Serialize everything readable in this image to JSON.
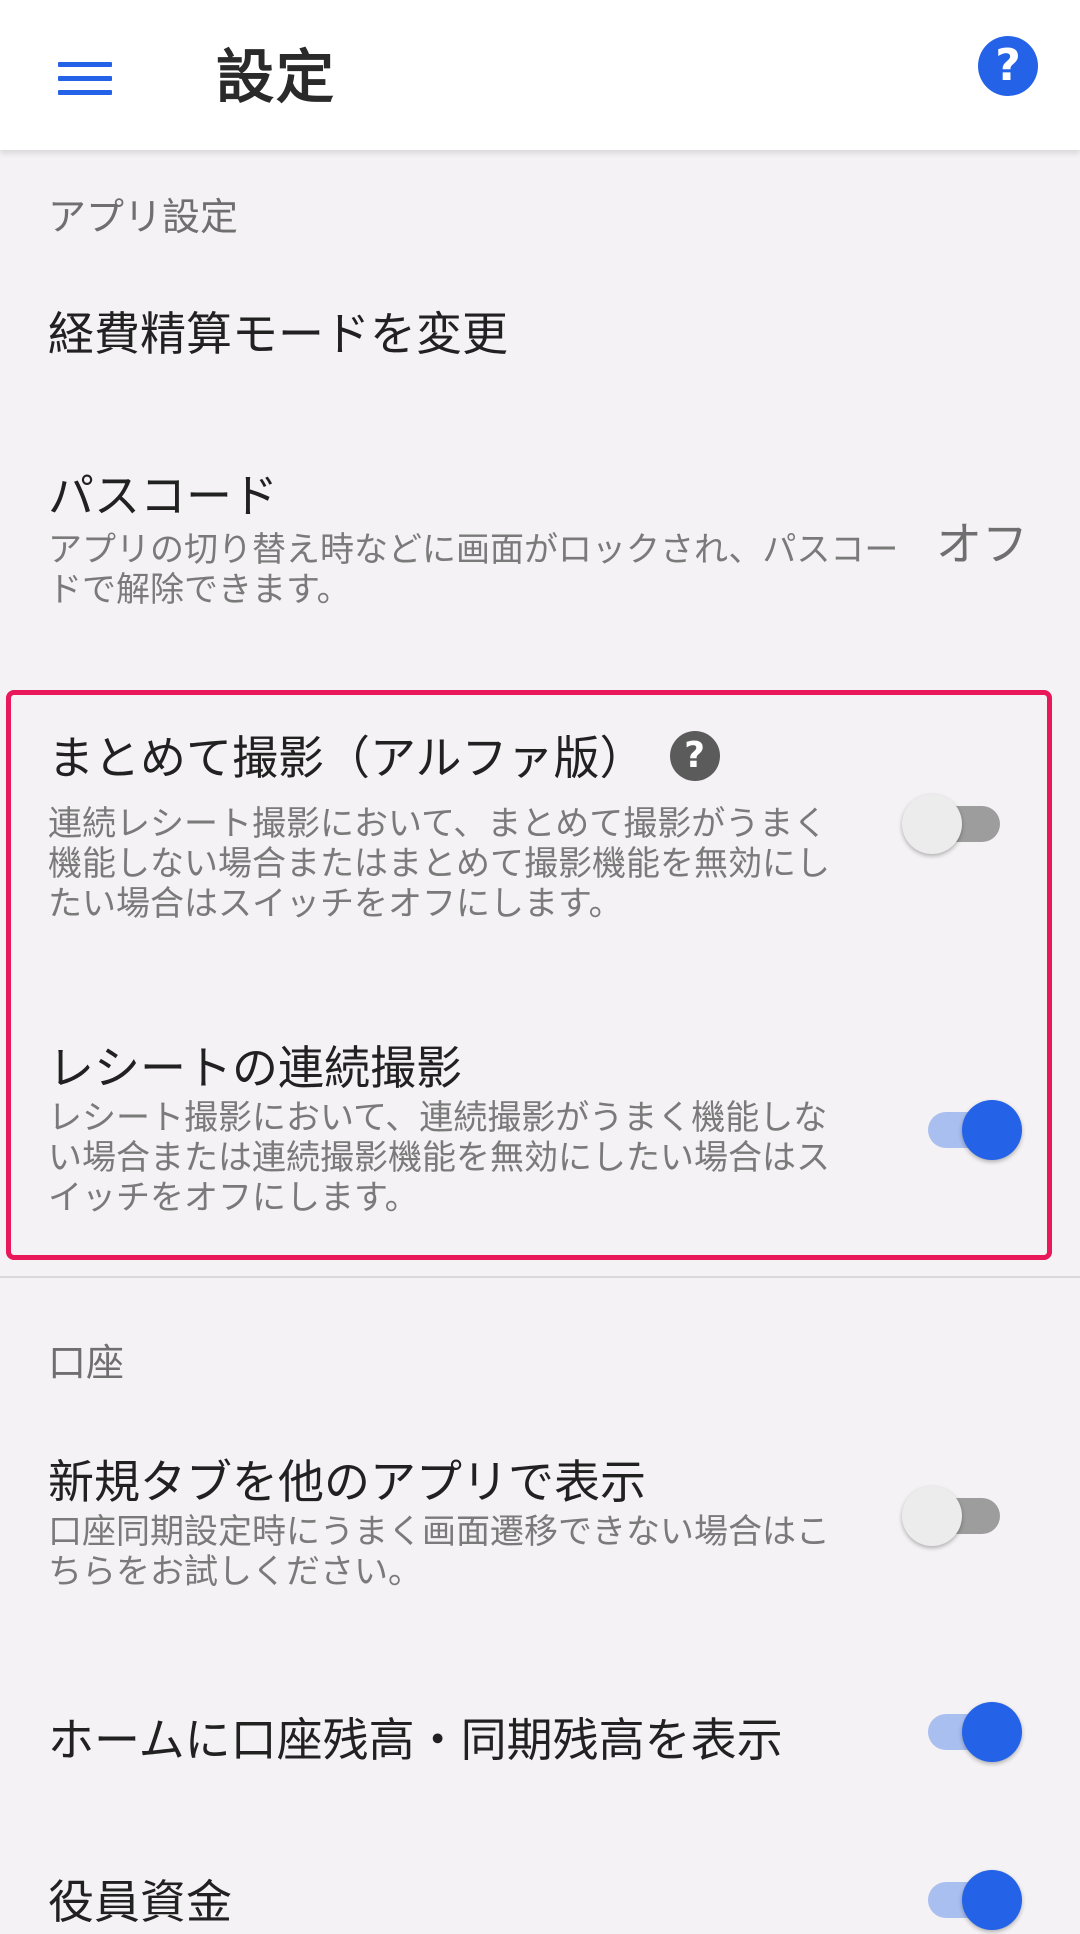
{
  "appbar": {
    "title": "設定",
    "menu_icon": "hamburger-menu-icon",
    "help_icon": "help-circle-icon",
    "help_glyph": "?"
  },
  "colors": {
    "accent": "#2462e8",
    "highlight_border": "#e8185a",
    "background": "#f4f2f4"
  },
  "app_settings": {
    "header": "アプリ設定",
    "expense_mode": {
      "title": "経費精算モードを変更"
    },
    "passcode": {
      "title": "パスコード",
      "description": "アプリの切り替え時などに画面がロックされ、パスコードで解除できます。",
      "value": "オフ"
    },
    "batch_capture": {
      "title": "まとめて撮影（アルファ版）",
      "help_glyph": "?",
      "description": "連続レシート撮影において、まとめて撮影がうまく機能しない場合またはまとめて撮影機能を無効にしたい場合はスイッチをオフにします。",
      "enabled": false
    },
    "continuous_capture": {
      "title": "レシートの連続撮影",
      "description": "レシート撮影において、連続撮影がうまく機能しない場合または連続撮影機能を無効にしたい場合はスイッチをオフにします。",
      "enabled": true
    }
  },
  "account": {
    "header": "口座",
    "open_new_tab": {
      "title": "新規タブを他のアプリで表示",
      "description": "口座同期設定時にうまく画面遷移できない場合はこちらをお試しください。",
      "enabled": false
    },
    "show_balance": {
      "title": "ホームに口座残高・同期残高を表示",
      "enabled": true
    },
    "officer_funds": {
      "title": "役員資金",
      "enabled": true
    }
  }
}
